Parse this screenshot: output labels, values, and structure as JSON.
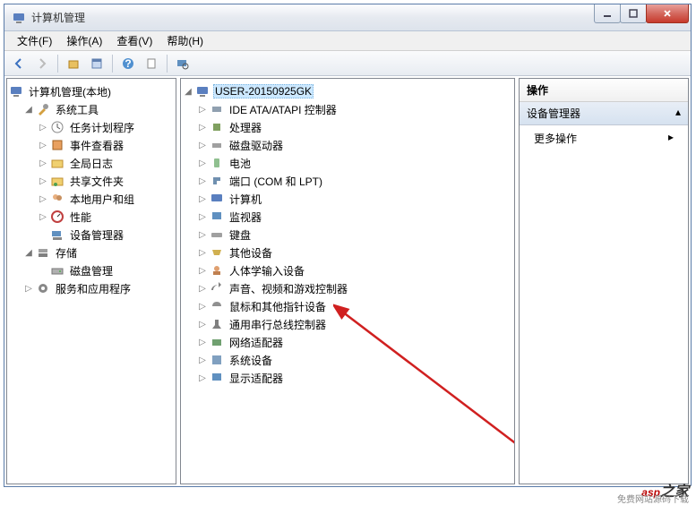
{
  "window": {
    "title": "计算机管理"
  },
  "menu": {
    "file": "文件(F)",
    "action": "操作(A)",
    "view": "查看(V)",
    "help": "帮助(H)"
  },
  "left_tree": {
    "root": "计算机管理(本地)",
    "system_tools": "系统工具",
    "task_scheduler": "任务计划程序",
    "event_viewer": "事件查看器",
    "shared_folders_a": "全局日志",
    "shared_folders": "共享文件夹",
    "local_users": "本地用户和组",
    "performance": "性能",
    "device_manager": "设备管理器",
    "storage": "存储",
    "disk_management": "磁盘管理",
    "services": "服务和应用程序"
  },
  "mid_tree": {
    "root": "USER-20150925GK",
    "items": [
      "IDE ATA/ATAPI 控制器",
      "处理器",
      "磁盘驱动器",
      "电池",
      "端口 (COM 和 LPT)",
      "计算机",
      "监视器",
      "键盘",
      "其他设备",
      "人体学输入设备",
      "声音、视频和游戏控制器",
      "鼠标和其他指针设备",
      "通用串行总线控制器",
      "网络适配器",
      "系统设备",
      "显示适配器"
    ]
  },
  "actions": {
    "header": "操作",
    "subheader": "设备管理器",
    "more": "更多操作"
  },
  "watermark": "asp",
  "watermark2": "之家",
  "watermark_sub": "免费网站源码下载"
}
